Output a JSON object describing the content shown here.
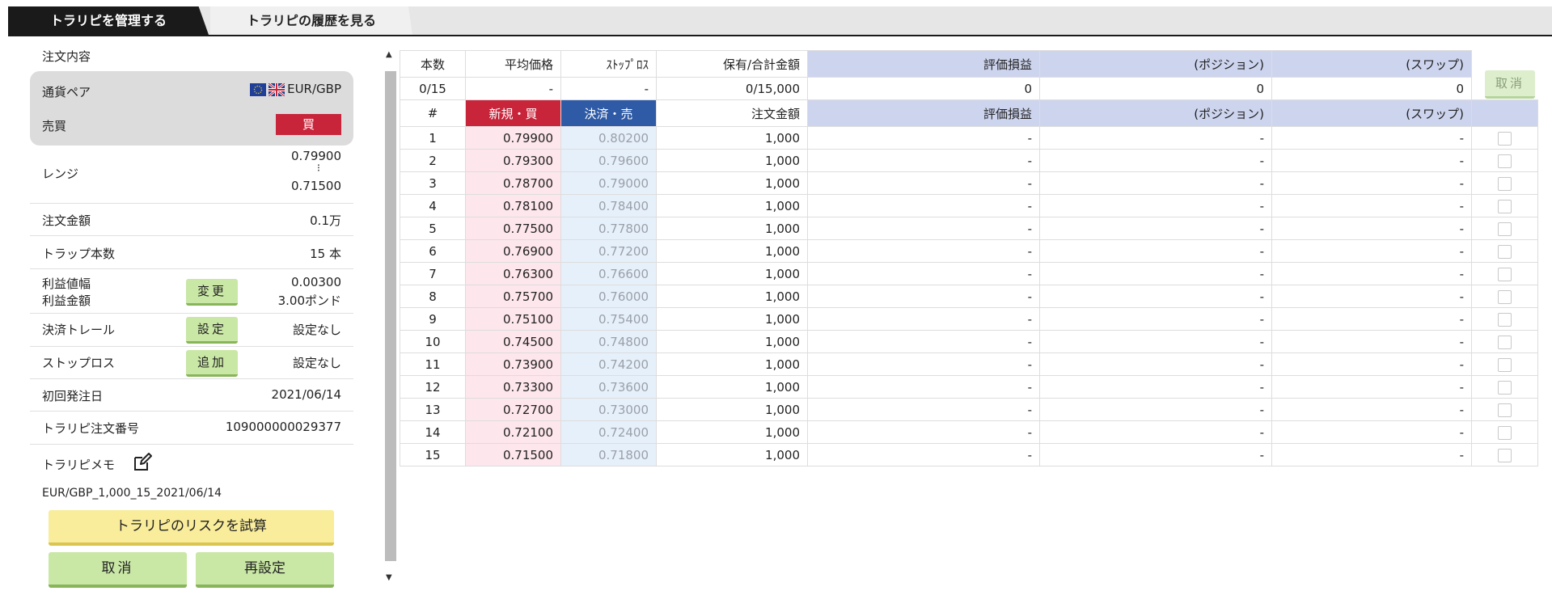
{
  "tabs": [
    {
      "label": "トラリピを管理する",
      "active": true
    },
    {
      "label": "トラリピの履歴を見る",
      "active": false
    }
  ],
  "order": {
    "section_title": "注文内容",
    "pair_label": "通貨ペア",
    "pair_value": "EUR/GBP",
    "side_label": "売買",
    "side_value": "買",
    "range_label": "レンジ",
    "range_high": "0.79900",
    "range_sep": "⁝",
    "range_low": "0.71500",
    "amount_label": "注文金額",
    "amount_value": "0.1万",
    "traps_label": "トラップ本数",
    "traps_value": "15 本",
    "profit_width_label": "利益値幅",
    "profit_amount_label": "利益金額",
    "profit_width_value": "0.00300",
    "profit_amount_value": "3.00ポンド",
    "change_button": "変更",
    "trail_label": "決済トレール",
    "trail_button": "設定",
    "trail_value": "設定なし",
    "stoploss_label": "ストップロス",
    "stoploss_button": "追加",
    "stoploss_value": "設定なし",
    "first_date_label": "初回発注日",
    "first_date_value": "2021/06/14",
    "order_no_label": "トラリピ注文番号",
    "order_no_value": "109000000029377",
    "memo_label": "トラリピメモ",
    "memo_value": "EUR/GBP_1,000_15_2021/06/14"
  },
  "actions": {
    "risk_button": "トラリピのリスクを試算",
    "cancel_button": "取消",
    "reset_button": "再設定",
    "cancel_top": "取消"
  },
  "summary": {
    "headers": [
      "本数",
      "平均価格",
      "ｽﾄｯﾌﾟﾛｽ",
      "保有/合計金額",
      "評価損益",
      "(ポジション)",
      "(スワップ)"
    ],
    "values": [
      "0/15",
      "-",
      "-",
      "0/15,000",
      "0",
      "0",
      "0"
    ]
  },
  "detail": {
    "headers": [
      "#",
      "新規・買",
      "決済・売",
      "注文金額",
      "評価損益",
      "(ポジション)",
      "(スワップ)"
    ],
    "rows": [
      [
        "1",
        "0.79900",
        "0.80200",
        "1,000",
        "-",
        "-",
        "-"
      ],
      [
        "2",
        "0.79300",
        "0.79600",
        "1,000",
        "-",
        "-",
        "-"
      ],
      [
        "3",
        "0.78700",
        "0.79000",
        "1,000",
        "-",
        "-",
        "-"
      ],
      [
        "4",
        "0.78100",
        "0.78400",
        "1,000",
        "-",
        "-",
        "-"
      ],
      [
        "5",
        "0.77500",
        "0.77800",
        "1,000",
        "-",
        "-",
        "-"
      ],
      [
        "6",
        "0.76900",
        "0.77200",
        "1,000",
        "-",
        "-",
        "-"
      ],
      [
        "7",
        "0.76300",
        "0.76600",
        "1,000",
        "-",
        "-",
        "-"
      ],
      [
        "8",
        "0.75700",
        "0.76000",
        "1,000",
        "-",
        "-",
        "-"
      ],
      [
        "9",
        "0.75100",
        "0.75400",
        "1,000",
        "-",
        "-",
        "-"
      ],
      [
        "10",
        "0.74500",
        "0.74800",
        "1,000",
        "-",
        "-",
        "-"
      ],
      [
        "11",
        "0.73900",
        "0.74200",
        "1,000",
        "-",
        "-",
        "-"
      ],
      [
        "12",
        "0.73300",
        "0.73600",
        "1,000",
        "-",
        "-",
        "-"
      ],
      [
        "13",
        "0.72700",
        "0.73000",
        "1,000",
        "-",
        "-",
        "-"
      ],
      [
        "14",
        "0.72100",
        "0.72400",
        "1,000",
        "-",
        "-",
        "-"
      ],
      [
        "15",
        "0.71500",
        "0.71800",
        "1,000",
        "-",
        "-",
        "-"
      ]
    ]
  },
  "colors": {
    "buy": "#c8243a",
    "sell": "#2e5aa6",
    "header_blue": "#cdd4ee",
    "button_green": "#c9e7a5",
    "button_yellow": "#f9ec9a"
  },
  "icons": [
    "eu-flag-icon",
    "uk-flag-icon",
    "edit-memo-icon",
    "scroll-up-icon",
    "scroll-down-icon"
  ]
}
